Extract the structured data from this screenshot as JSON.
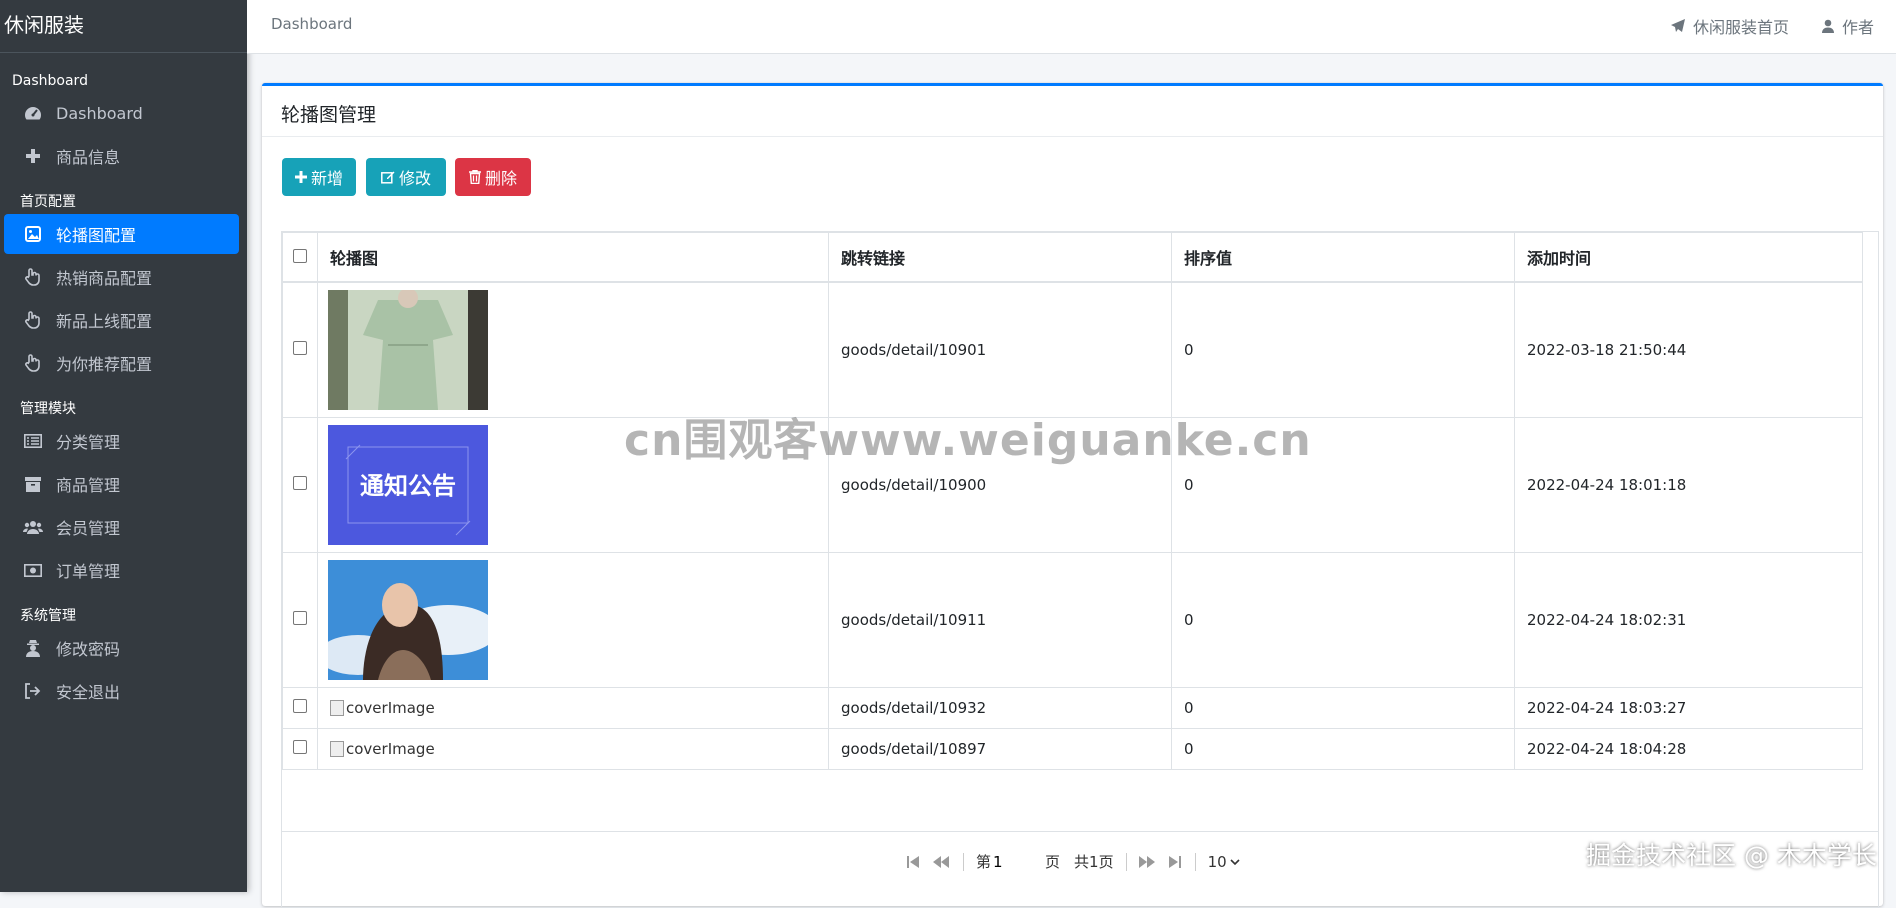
{
  "sidebar": {
    "brand": "休闲服装",
    "sections": [
      {
        "title": "Dashboard",
        "items": [
          {
            "label": "Dashboard",
            "icon": "dashboard-icon"
          },
          {
            "label": "商品信息",
            "icon": "plus-icon"
          }
        ]
      },
      {
        "title": "首页配置",
        "items": [
          {
            "label": "轮播图配置",
            "icon": "image-icon",
            "active": true
          },
          {
            "label": "热销商品配置",
            "icon": "hand-pointer-icon"
          },
          {
            "label": "新品上线配置",
            "icon": "hand-pointer-icon"
          },
          {
            "label": "为你推荐配置",
            "icon": "hand-pointer-icon"
          }
        ]
      },
      {
        "title": "管理模块",
        "items": [
          {
            "label": "分类管理",
            "icon": "list-icon"
          },
          {
            "label": "商品管理",
            "icon": "archive-icon"
          },
          {
            "label": "会员管理",
            "icon": "users-icon"
          },
          {
            "label": "订单管理",
            "icon": "money-icon"
          }
        ]
      },
      {
        "title": "系统管理",
        "items": [
          {
            "label": "修改密码",
            "icon": "user-secret-icon"
          },
          {
            "label": "安全退出",
            "icon": "sign-out-icon"
          }
        ]
      }
    ]
  },
  "topbar": {
    "breadcrumb": "Dashboard",
    "home_link": "休闲服装首页",
    "author_link": "作者"
  },
  "card": {
    "title": "轮播图管理",
    "buttons": {
      "add": "新增",
      "edit": "修改",
      "delete": "删除"
    },
    "colors": {
      "info": "#17a2b8",
      "danger": "#dc3545",
      "accent": "#007bff"
    }
  },
  "table": {
    "headers": [
      "轮播图",
      "跳转链接",
      "排序值",
      "添加时间"
    ],
    "rows": [
      {
        "image": "green-dress-photo",
        "image_alt": "",
        "link": "goods/detail/10901",
        "order": "0",
        "time": "2022-03-18 21:50:44"
      },
      {
        "image": "notice-banner",
        "image_text": "通知公告",
        "link": "goods/detail/10900",
        "order": "0",
        "time": "2022-04-24 18:01:18"
      },
      {
        "image": "girl-sky-photo",
        "image_alt": "",
        "link": "goods/detail/10911",
        "order": "0",
        "time": "2022-04-24 18:02:31"
      },
      {
        "image": "broken",
        "image_alt": "coverImage",
        "link": "goods/detail/10932",
        "order": "0",
        "time": "2022-04-24 18:03:27"
      },
      {
        "image": "broken",
        "image_alt": "coverImage",
        "link": "goods/detail/10897",
        "order": "0",
        "time": "2022-04-24 18:04:28"
      }
    ]
  },
  "pager": {
    "page_prefix": "第",
    "page_value": "1",
    "page_suffix": "页",
    "total": "共1页",
    "page_size": "10"
  },
  "watermarks": {
    "center": "cn围观客www.weiguanke.cn",
    "corner": "掘金技术社区 @ 木木学长"
  }
}
